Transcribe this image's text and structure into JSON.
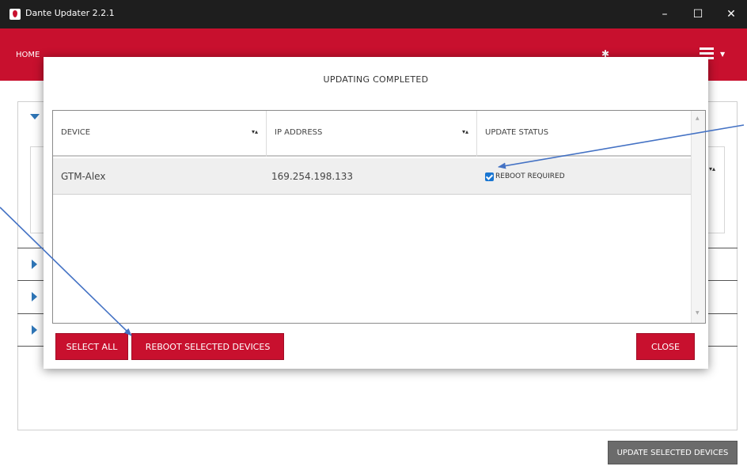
{
  "window": {
    "title": "Dante Updater 2.2.1",
    "minimize_glyph": "–",
    "maximize_glyph": "☐",
    "close_glyph": "✕"
  },
  "header": {
    "home_tab": "HOME",
    "gear_icon": "gear-icon",
    "menu_icon": "hamburger-menu-icon"
  },
  "main": {
    "update_selected_button": "UPDATE SELECTED DEVICES"
  },
  "modal": {
    "title": "UPDATING COMPLETED",
    "columns": [
      {
        "label": "DEVICE",
        "sort": "▾▴"
      },
      {
        "label": "IP ADDRESS",
        "sort": "▾▴"
      },
      {
        "label": "UPDATE STATUS",
        "sort": ""
      }
    ],
    "rows": [
      {
        "device": "GTM-Alex",
        "ip": "169.254.198.133",
        "status": "REBOOT REQUIRED",
        "checked": true
      }
    ],
    "buttons": {
      "select_all": "SELECT ALL",
      "reboot_selected": "REBOOT SELECTED DEVICES",
      "close": "CLOSE"
    }
  },
  "colors": {
    "brand_red": "#c8102e",
    "titlebar": "#1e1e1e",
    "annotation_arrow": "#4472c4",
    "checkbox": "#1976d2"
  }
}
